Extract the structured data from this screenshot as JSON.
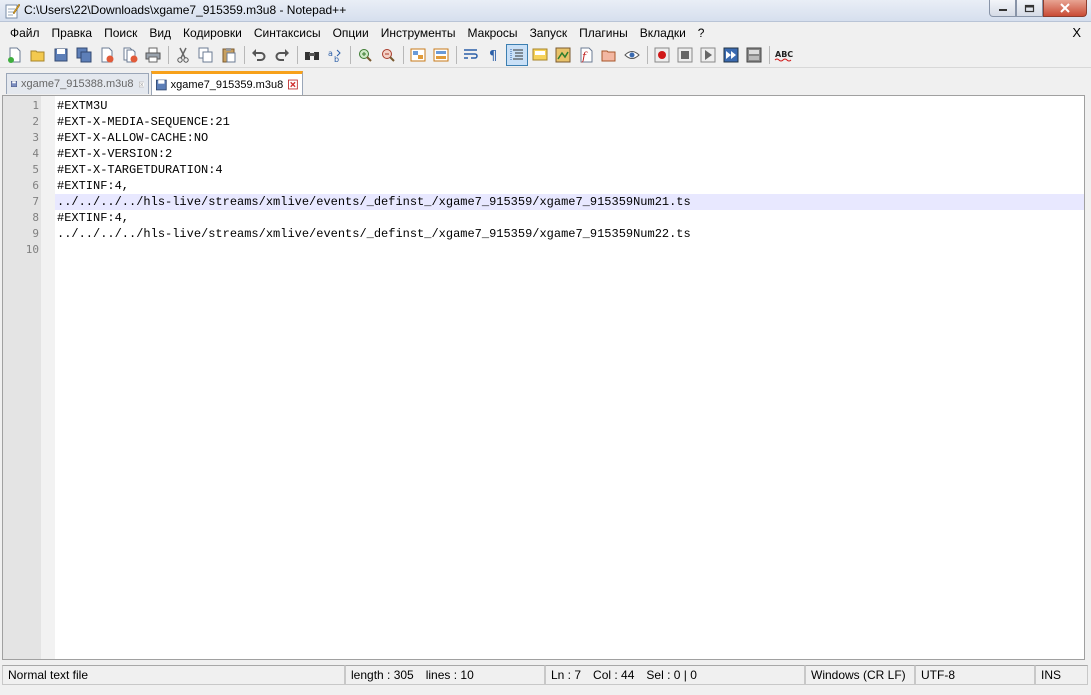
{
  "window": {
    "title": "C:\\Users\\22\\Downloads\\xgame7_915359.m3u8 - Notepad++"
  },
  "menu": {
    "items": [
      "Файл",
      "Правка",
      "Поиск",
      "Вид",
      "Кодировки",
      "Синтаксисы",
      "Опции",
      "Инструменты",
      "Макросы",
      "Запуск",
      "Плагины",
      "Вкладки",
      "?"
    ],
    "close_label": "X"
  },
  "toolbar": {
    "buttons": [
      "new-file",
      "open-file",
      "save",
      "save-all",
      "close",
      "close-all",
      "print",
      "cut",
      "copy",
      "paste",
      "undo",
      "redo",
      "find",
      "replace",
      "zoom-in",
      "zoom-out",
      "sync-vertical",
      "sync-horizontal",
      "word-wrap",
      "show-all-chars",
      "indent-guide",
      "user-defined-language",
      "document-map",
      "function-list",
      "folder-as-workspace",
      "monitoring",
      "record-macro",
      "stop-recording",
      "play-macro",
      "run-macro-multiple",
      "save-macro",
      "spell-check"
    ],
    "spell_check_label": "ABC"
  },
  "tabs": [
    {
      "label": "xgame7_915388.m3u8",
      "active": false
    },
    {
      "label": "xgame7_915359.m3u8",
      "active": true
    }
  ],
  "editor": {
    "current_line": 7,
    "lines": [
      "#EXTM3U",
      "#EXT-X-MEDIA-SEQUENCE:21",
      "#EXT-X-ALLOW-CACHE:NO",
      "#EXT-X-VERSION:2",
      "#EXT-X-TARGETDURATION:4",
      "#EXTINF:4,",
      "../../../../hls-live/streams/xmlive/events/_definst_/xgame7_915359/xgame7_915359Num21.ts",
      "#EXTINF:4,",
      "../../../../hls-live/streams/xmlive/events/_definst_/xgame7_915359/xgame7_915359Num22.ts",
      ""
    ]
  },
  "status": {
    "file_type": "Normal text file",
    "length": "length : 305",
    "lines": "lines : 10",
    "ln": "Ln : 7",
    "col": "Col : 44",
    "sel": "Sel : 0 | 0",
    "eol": "Windows (CR LF)",
    "encoding": "UTF-8",
    "mode": "INS"
  }
}
